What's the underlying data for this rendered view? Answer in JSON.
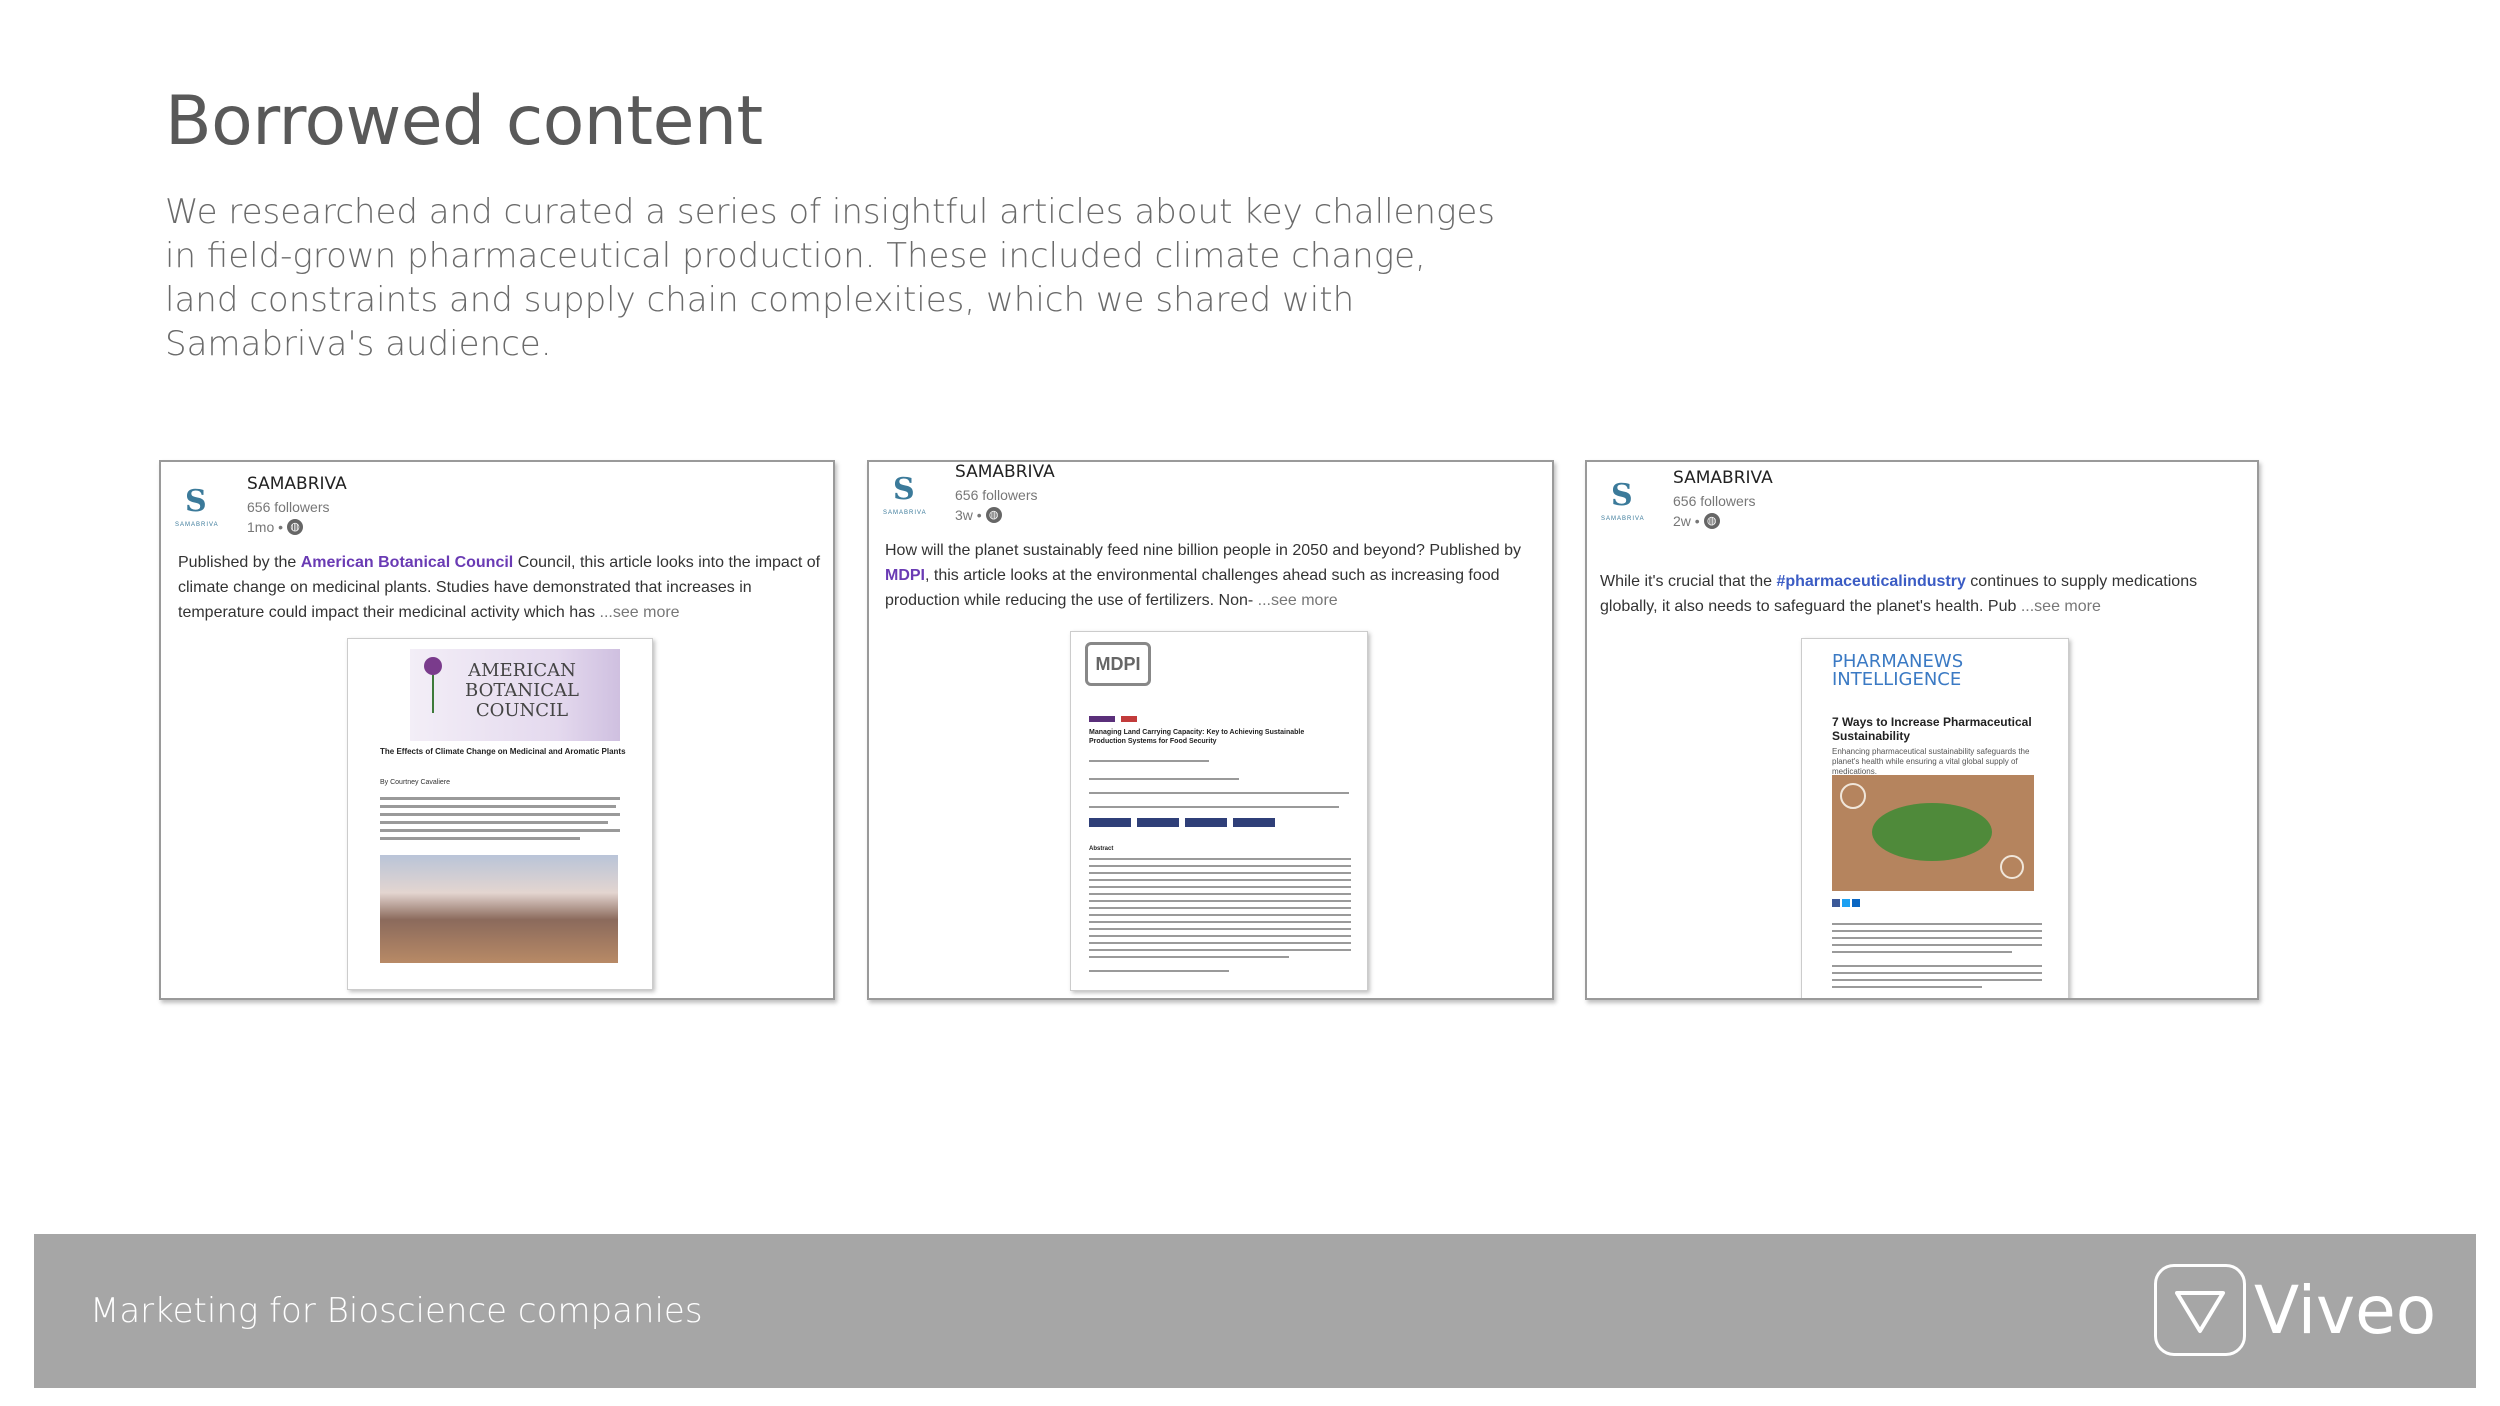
{
  "slide": {
    "title": "Borrowed content",
    "intro": "We researched and curated a series of insightful articles about key challenges in field-grown pharmaceutical production. These included climate change, land constraints and supply chain complexities, which we shared with Samabriva's audience."
  },
  "posts": [
    {
      "author": "SAMABRIVA",
      "followers": "656 followers",
      "time": "1mo •",
      "text_pre": "Published by the ",
      "link": "American Botanical Council",
      "text_post": " Council, this article looks into the impact of climate change on medicinal plants. Studies have demonstrated that increases in temperature could impact their medicinal activity which has",
      "more": "...see more",
      "doc": {
        "org_line1": "AMERICAN",
        "org_line2": "BOTANICAL",
        "org_line3": "COUNCIL",
        "title": "The Effects of Climate Change on Medicinal and Aromatic Plants",
        "byline": "By Courtney Cavaliere"
      }
    },
    {
      "author": "SAMABRIVA",
      "followers": "656 followers",
      "time": "3w •",
      "text_pre": "How will the planet sustainably feed nine billion people in 2050 and beyond? Published by ",
      "link": "MDPI",
      "text_post": ", this article looks at the environmental challenges ahead such as increasing food production while reducing the use of fertilizers. Non-",
      "more": "...see more",
      "doc": {
        "publisher": "MDPI",
        "title": "Managing Land Carrying Capacity: Key to Achieving Sustainable Production Systems for Food Security",
        "section": "Abstract"
      }
    },
    {
      "author": "SAMABRIVA",
      "followers": "656 followers",
      "time": "2w •",
      "text_pre": "While it's crucial that the ",
      "link": "#pharmaceuticalindustry",
      "text_post": " continues to supply medications globally, it also needs to safeguard the planet's health. Pub",
      "more": "...see more",
      "doc": {
        "brand1": "PHARMANEWS",
        "brand2": "INTELLIGENCE",
        "title": "7 Ways to Increase Pharmaceutical Sustainability",
        "summary": "Enhancing pharmaceutical sustainability safeguards the planet's health while ensuring a vital global supply of medications."
      }
    }
  ],
  "footer": {
    "tagline": "Marketing for Bioscience companies",
    "brand": "Viveo"
  }
}
